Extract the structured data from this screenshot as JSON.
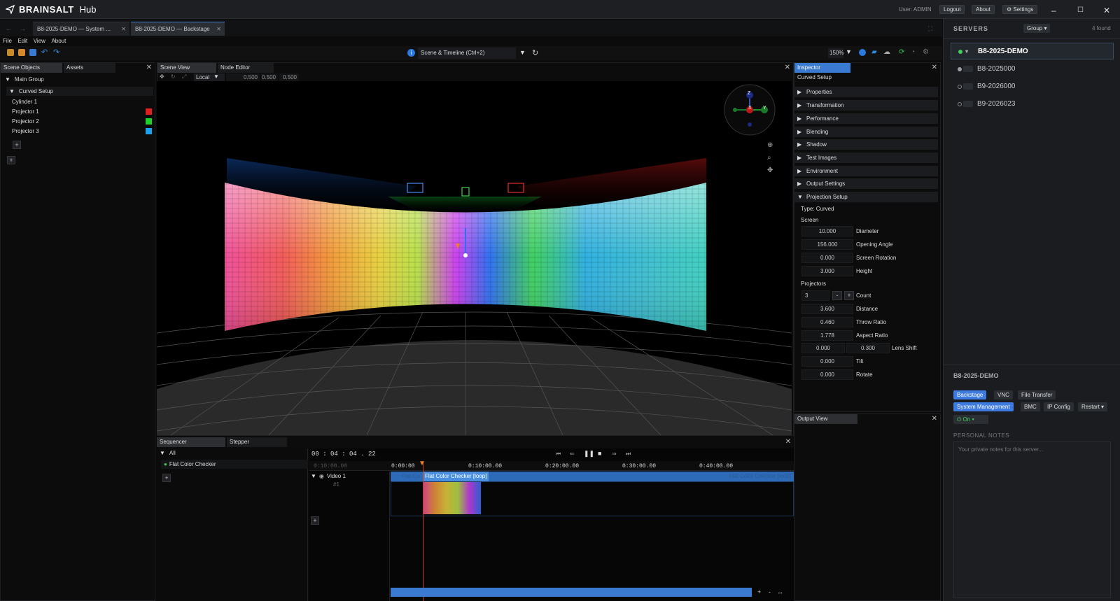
{
  "app": {
    "brand": "BRAINSALT",
    "product": "Hub",
    "user": "User: ADMIN",
    "logout": "Logout",
    "about": "About",
    "settings": "⚙ Settings"
  },
  "window_controls": {
    "minimize": "–",
    "maximize": "☐",
    "close": "✕"
  },
  "tabs": [
    {
      "label": "B8-2025-DEMO — System ..."
    },
    {
      "label": "B8-2025-DEMO — Backstage"
    }
  ],
  "menu": [
    "File",
    "Edit",
    "View",
    "About"
  ],
  "scene_selector": {
    "label": "Scene & Timeline  (Ctrl+2)",
    "zoom": "150%"
  },
  "left_panel": {
    "tabs": [
      "Scene Objects",
      "Assets"
    ],
    "tree": {
      "group": "Main Group",
      "subgroup": "Curved Setup",
      "items": [
        {
          "name": "Cylinder 1",
          "color": ""
        },
        {
          "name": "Projector 1",
          "color": "#e02020"
        },
        {
          "name": "Projector 2",
          "color": "#22d02a"
        },
        {
          "name": "Projector 3",
          "color": "#1ea0ea"
        }
      ]
    }
  },
  "center_panel": {
    "tabs": [
      "Scene View",
      "Node Editor"
    ],
    "transform_space": "Local",
    "values": [
      "0.500",
      "0.500",
      "0.500"
    ],
    "gizmo": {
      "z": "Z",
      "x": "X",
      "y": "Y"
    }
  },
  "inspector": {
    "tab": "Inspector",
    "title": "Curved Setup",
    "sections": [
      "Properties",
      "Transformation",
      "Performance",
      "Blending",
      "Shadow",
      "Test Images",
      "Environment",
      "Output Settings",
      "Projection Setup"
    ],
    "type_label": "Type: Curved",
    "screen_label": "Screen",
    "screen_fields": [
      {
        "value": "10.000",
        "label": "Diameter"
      },
      {
        "value": "156.000",
        "label": "Opening Angle"
      },
      {
        "value": "0.000",
        "label": "Screen Rotation"
      },
      {
        "value": "3.000",
        "label": "Height"
      }
    ],
    "projectors_label": "Projectors",
    "count": {
      "value": "3",
      "minus": "-",
      "plus": "+",
      "label": "Count"
    },
    "proj_fields": [
      {
        "value": "3.600",
        "label": "Distance"
      },
      {
        "value": "0.460",
        "label": "Throw Ratio"
      },
      {
        "value": "1.778",
        "label": "Aspect Ratio"
      }
    ],
    "lens_shift": {
      "x": "0.000",
      "y": "0.300",
      "label": "Lens Shift"
    },
    "proj_fields2": [
      {
        "value": "0.000",
        "label": "Tilt"
      },
      {
        "value": "0.000",
        "label": "Rotate"
      }
    ],
    "output_view": "Output View"
  },
  "sequencer": {
    "tabs": [
      "Sequencer",
      "Stepper"
    ],
    "all": "All",
    "item": "Flat Color Checker",
    "timecode": "00 : 04 : 04 . 22",
    "ruler": [
      "0:10:00.00",
      "0:00:00",
      "0:10:00.00",
      "0:20:00.00",
      "0:30:00.00",
      "0:40:00.00"
    ],
    "track": "Video 1",
    "track_sub": "#1",
    "clip_label": "Flat Color Checker [loop]",
    "clip_ghost": "Flat Co",
    "clip_end": "Flat Color Checker [loop]",
    "zoom_controls": [
      "+",
      "-",
      "↔"
    ]
  },
  "servers": {
    "title": "SERVERS",
    "group": "Group ▾",
    "count": "4 found",
    "list": [
      {
        "name": "B8-2025-DEMO",
        "status": "online",
        "color": "#3ecf5a"
      },
      {
        "name": "B8-2025000",
        "status": "idle",
        "color": "#9aa0a6"
      },
      {
        "name": "B9-2026000",
        "status": "offline",
        "color": ""
      },
      {
        "name": "B9-2026023",
        "status": "offline",
        "color": ""
      }
    ],
    "detail_title": "B8-2025-DEMO",
    "buttons_row1": [
      "Backstage",
      "VNC",
      "File Transfer"
    ],
    "buttons_row2": [
      "System Management",
      "BMC",
      "IP Config",
      "Restart ▾"
    ],
    "power": "⏻ On ▾",
    "notes_label": "PERSONAL NOTES",
    "notes_placeholder": "Your private notes for this server..."
  },
  "colors": {
    "accent": "#3a7ad1",
    "bg": "#0b0b0b"
  }
}
